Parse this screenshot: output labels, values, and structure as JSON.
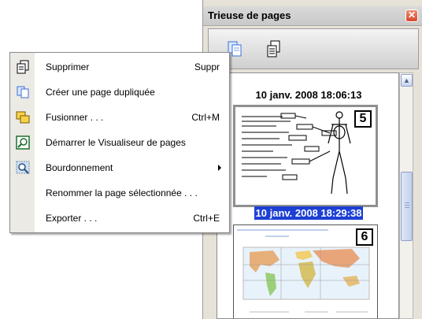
{
  "sorter": {
    "title": "Trieuse de pages",
    "close_glyph": "✕",
    "toolbar_icons": [
      "duplicate-page-icon",
      "delete-page-icon"
    ],
    "pages": [
      {
        "date": "10 janv. 2008 18:06:13",
        "number": "5",
        "selected": false
      },
      {
        "date": "10 janv. 2008 18:29:38",
        "number": "6",
        "selected": true
      }
    ]
  },
  "context_menu": {
    "items": [
      {
        "label": "Supprimer",
        "shortcut": "Suppr",
        "icon": "delete-page-icon"
      },
      {
        "label": "Créer une page dupliquée",
        "shortcut": "",
        "icon": "duplicate-page-icon"
      },
      {
        "label": "Fusionner . . .",
        "shortcut": "Ctrl+M",
        "icon": "merge-icon"
      },
      {
        "label": "Démarrer le Visualiseur de pages",
        "shortcut": "",
        "icon": "page-viewer-icon"
      },
      {
        "label": "Bourdonnement",
        "shortcut": "",
        "icon": "zoom-icon",
        "submenu": true
      },
      {
        "label": "Renommer la page sélectionnée . . .",
        "shortcut": "",
        "icon": ""
      },
      {
        "label": "Exporter . . .",
        "shortcut": "Ctrl+E",
        "icon": ""
      }
    ]
  },
  "colors": {
    "selection": "#1c3fd4",
    "menu_gutter": "#eceae4",
    "close_button": "#d6482c"
  }
}
